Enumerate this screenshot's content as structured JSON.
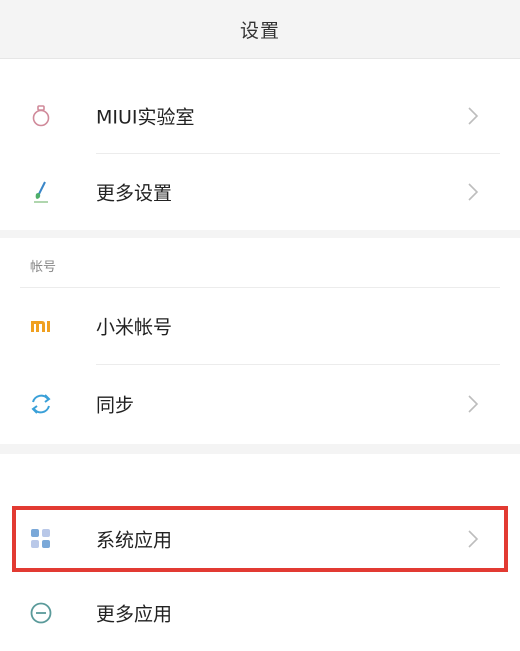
{
  "header": {
    "title": "设置"
  },
  "rows": {
    "miui_lab": {
      "label": "MIUI实验室",
      "icon": "flask-icon",
      "has_chevron": true
    },
    "more_settings": {
      "label": "更多设置",
      "icon": "brush-icon",
      "has_chevron": true
    },
    "xiaomi_account": {
      "label": "小米帐号",
      "icon": "mi-logo-icon",
      "has_chevron": false
    },
    "sync": {
      "label": "同步",
      "icon": "sync-icon",
      "has_chevron": true
    },
    "system_apps": {
      "label": "系统应用",
      "icon": "app-grid-icon",
      "has_chevron": true,
      "highlighted": true
    },
    "more_apps": {
      "label": "更多应用",
      "icon": "minus-circle-icon",
      "has_chevron": false
    }
  },
  "sections": {
    "account_label": "帐号"
  },
  "colors": {
    "highlight": "#e23a32",
    "mi_orange": "#f0a020",
    "header_bg": "#f4f4f4"
  }
}
